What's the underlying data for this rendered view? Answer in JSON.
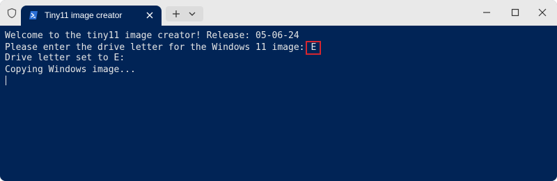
{
  "window": {
    "tab_title": "Tiny11 image creator",
    "accent_bg": "#012456",
    "highlight_color": "#d7262f"
  },
  "icons": {
    "shield": "shield-icon",
    "powershell": "powershell-icon",
    "close_tab": "close-icon",
    "new_tab": "plus-icon",
    "dropdown": "chevron-down-icon",
    "minimize": "minimize-icon",
    "maximize": "maximize-icon",
    "close_window": "close-icon"
  },
  "terminal": {
    "line1": "Welcome to the tiny11 image creator! Release: 05-06-24",
    "line2_prompt": "Please enter the drive letter for the Windows 11 image:",
    "line2_input": "E",
    "line3": "Drive letter set to E:",
    "line4": "Copying Windows image..."
  }
}
